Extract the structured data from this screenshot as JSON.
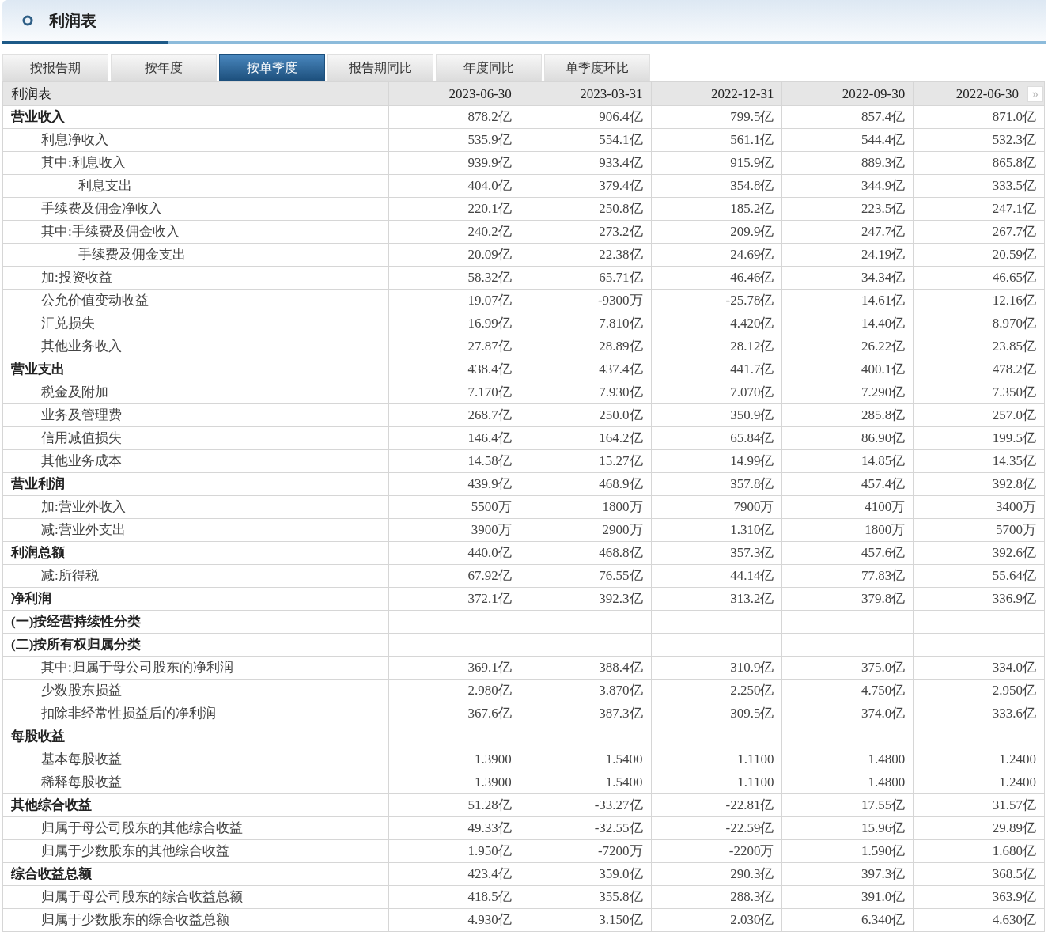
{
  "title": "利润表",
  "tabs": [
    {
      "label": "按报告期",
      "selected": false
    },
    {
      "label": "按年度",
      "selected": false
    },
    {
      "label": "按单季度",
      "selected": true
    },
    {
      "label": "报告期同比",
      "selected": false
    },
    {
      "label": "年度同比",
      "selected": false
    },
    {
      "label": "单季度环比",
      "selected": false
    }
  ],
  "table": {
    "columns": [
      "利润表",
      "2023-06-30",
      "2023-03-31",
      "2022-12-31",
      "2022-09-30",
      "2022-06-30"
    ],
    "next_button": "»",
    "rows": [
      {
        "label": "营业收入",
        "values": [
          "878.2亿",
          "906.4亿",
          "799.5亿",
          "857.4亿",
          "871.0亿"
        ],
        "children": [
          {
            "label": "利息净收入",
            "values": [
              "535.9亿",
              "554.1亿",
              "561.1亿",
              "544.4亿",
              "532.3亿"
            ]
          },
          {
            "label": "其中:利息收入",
            "values": [
              "939.9亿",
              "933.4亿",
              "915.9亿",
              "889.3亿",
              "865.8亿"
            ],
            "children": [
              {
                "label": "利息支出",
                "values": [
                  "404.0亿",
                  "379.4亿",
                  "354.8亿",
                  "344.9亿",
                  "333.5亿"
                ]
              }
            ]
          },
          {
            "label": "手续费及佣金净收入",
            "values": [
              "220.1亿",
              "250.8亿",
              "185.2亿",
              "223.5亿",
              "247.1亿"
            ]
          },
          {
            "label": "其中:手续费及佣金收入",
            "values": [
              "240.2亿",
              "273.2亿",
              "209.9亿",
              "247.7亿",
              "267.7亿"
            ],
            "children": [
              {
                "label": "手续费及佣金支出",
                "values": [
                  "20.09亿",
                  "22.38亿",
                  "24.69亿",
                  "24.19亿",
                  "20.59亿"
                ]
              }
            ]
          },
          {
            "label": "加:投资收益",
            "values": [
              "58.32亿",
              "65.71亿",
              "46.46亿",
              "34.34亿",
              "46.65亿"
            ]
          },
          {
            "label": "公允价值变动收益",
            "values": [
              "19.07亿",
              "-9300万",
              "-25.78亿",
              "14.61亿",
              "12.16亿"
            ]
          },
          {
            "label": "汇兑损失",
            "values": [
              "16.99亿",
              "7.810亿",
              "4.420亿",
              "14.40亿",
              "8.970亿"
            ]
          },
          {
            "label": "其他业务收入",
            "values": [
              "27.87亿",
              "28.89亿",
              "28.12亿",
              "26.22亿",
              "23.85亿"
            ]
          }
        ]
      },
      {
        "label": "营业支出",
        "values": [
          "438.4亿",
          "437.4亿",
          "441.7亿",
          "400.1亿",
          "478.2亿"
        ],
        "children": [
          {
            "label": "税金及附加",
            "values": [
              "7.170亿",
              "7.930亿",
              "7.070亿",
              "7.290亿",
              "7.350亿"
            ]
          },
          {
            "label": "业务及管理费",
            "values": [
              "268.7亿",
              "250.0亿",
              "350.9亿",
              "285.8亿",
              "257.0亿"
            ]
          },
          {
            "label": "信用减值损失",
            "values": [
              "146.4亿",
              "164.2亿",
              "65.84亿",
              "86.90亿",
              "199.5亿"
            ]
          },
          {
            "label": "其他业务成本",
            "values": [
              "14.58亿",
              "15.27亿",
              "14.99亿",
              "14.85亿",
              "14.35亿"
            ]
          }
        ]
      },
      {
        "label": "营业利润",
        "values": [
          "439.9亿",
          "468.9亿",
          "357.8亿",
          "457.4亿",
          "392.8亿"
        ],
        "children": [
          {
            "label": "加:营业外收入",
            "values": [
              "5500万",
              "1800万",
              "7900万",
              "4100万",
              "3400万"
            ]
          },
          {
            "label": "减:营业外支出",
            "values": [
              "3900万",
              "2900万",
              "1.310亿",
              "1800万",
              "5700万"
            ]
          }
        ]
      },
      {
        "label": "利润总额",
        "values": [
          "440.0亿",
          "468.8亿",
          "357.3亿",
          "457.6亿",
          "392.6亿"
        ],
        "children": [
          {
            "label": "减:所得税",
            "values": [
              "67.92亿",
              "76.55亿",
              "44.14亿",
              "77.83亿",
              "55.64亿"
            ]
          }
        ]
      },
      {
        "label": "净利润",
        "values": [
          "372.1亿",
          "392.3亿",
          "313.2亿",
          "379.8亿",
          "336.9亿"
        ]
      },
      {
        "label": "(一)按经营持续性分类"
      },
      {
        "label": "(二)按所有权归属分类",
        "children": [
          {
            "label": "其中:归属于母公司股东的净利润",
            "values": [
              "369.1亿",
              "388.4亿",
              "310.9亿",
              "375.0亿",
              "334.0亿"
            ]
          },
          {
            "label": "少数股东损益",
            "values": [
              "2.980亿",
              "3.870亿",
              "2.250亿",
              "4.750亿",
              "2.950亿"
            ]
          },
          {
            "label": "扣除非经常性损益后的净利润",
            "values": [
              "367.6亿",
              "387.3亿",
              "309.5亿",
              "374.0亿",
              "333.6亿"
            ]
          }
        ]
      },
      {
        "label": "每股收益",
        "children": [
          {
            "label": "基本每股收益",
            "values": [
              "1.3900",
              "1.5400",
              "1.1100",
              "1.4800",
              "1.2400"
            ]
          },
          {
            "label": "稀释每股收益",
            "values": [
              "1.3900",
              "1.5400",
              "1.1100",
              "1.4800",
              "1.2400"
            ]
          }
        ]
      },
      {
        "label": "其他综合收益",
        "values": [
          "51.28亿",
          "-33.27亿",
          "-22.81亿",
          "17.55亿",
          "31.57亿"
        ],
        "children": [
          {
            "label": "归属于母公司股东的其他综合收益",
            "values": [
              "49.33亿",
              "-32.55亿",
              "-22.59亿",
              "15.96亿",
              "29.89亿"
            ]
          },
          {
            "label": "归属于少数股东的其他综合收益",
            "values": [
              "1.950亿",
              "-7200万",
              "-2200万",
              "1.590亿",
              "1.680亿"
            ]
          }
        ]
      },
      {
        "label": "综合收益总额",
        "values": [
          "423.4亿",
          "359.0亿",
          "290.3亿",
          "397.3亿",
          "368.5亿"
        ],
        "children": [
          {
            "label": "归属于母公司股东的综合收益总额",
            "values": [
              "418.5亿",
              "355.8亿",
              "288.3亿",
              "391.0亿",
              "363.9亿"
            ]
          },
          {
            "label": "归属于少数股东的综合收益总额",
            "values": [
              "4.930亿",
              "3.150亿",
              "2.030亿",
              "6.340亿",
              "4.630亿"
            ]
          }
        ]
      }
    ]
  }
}
